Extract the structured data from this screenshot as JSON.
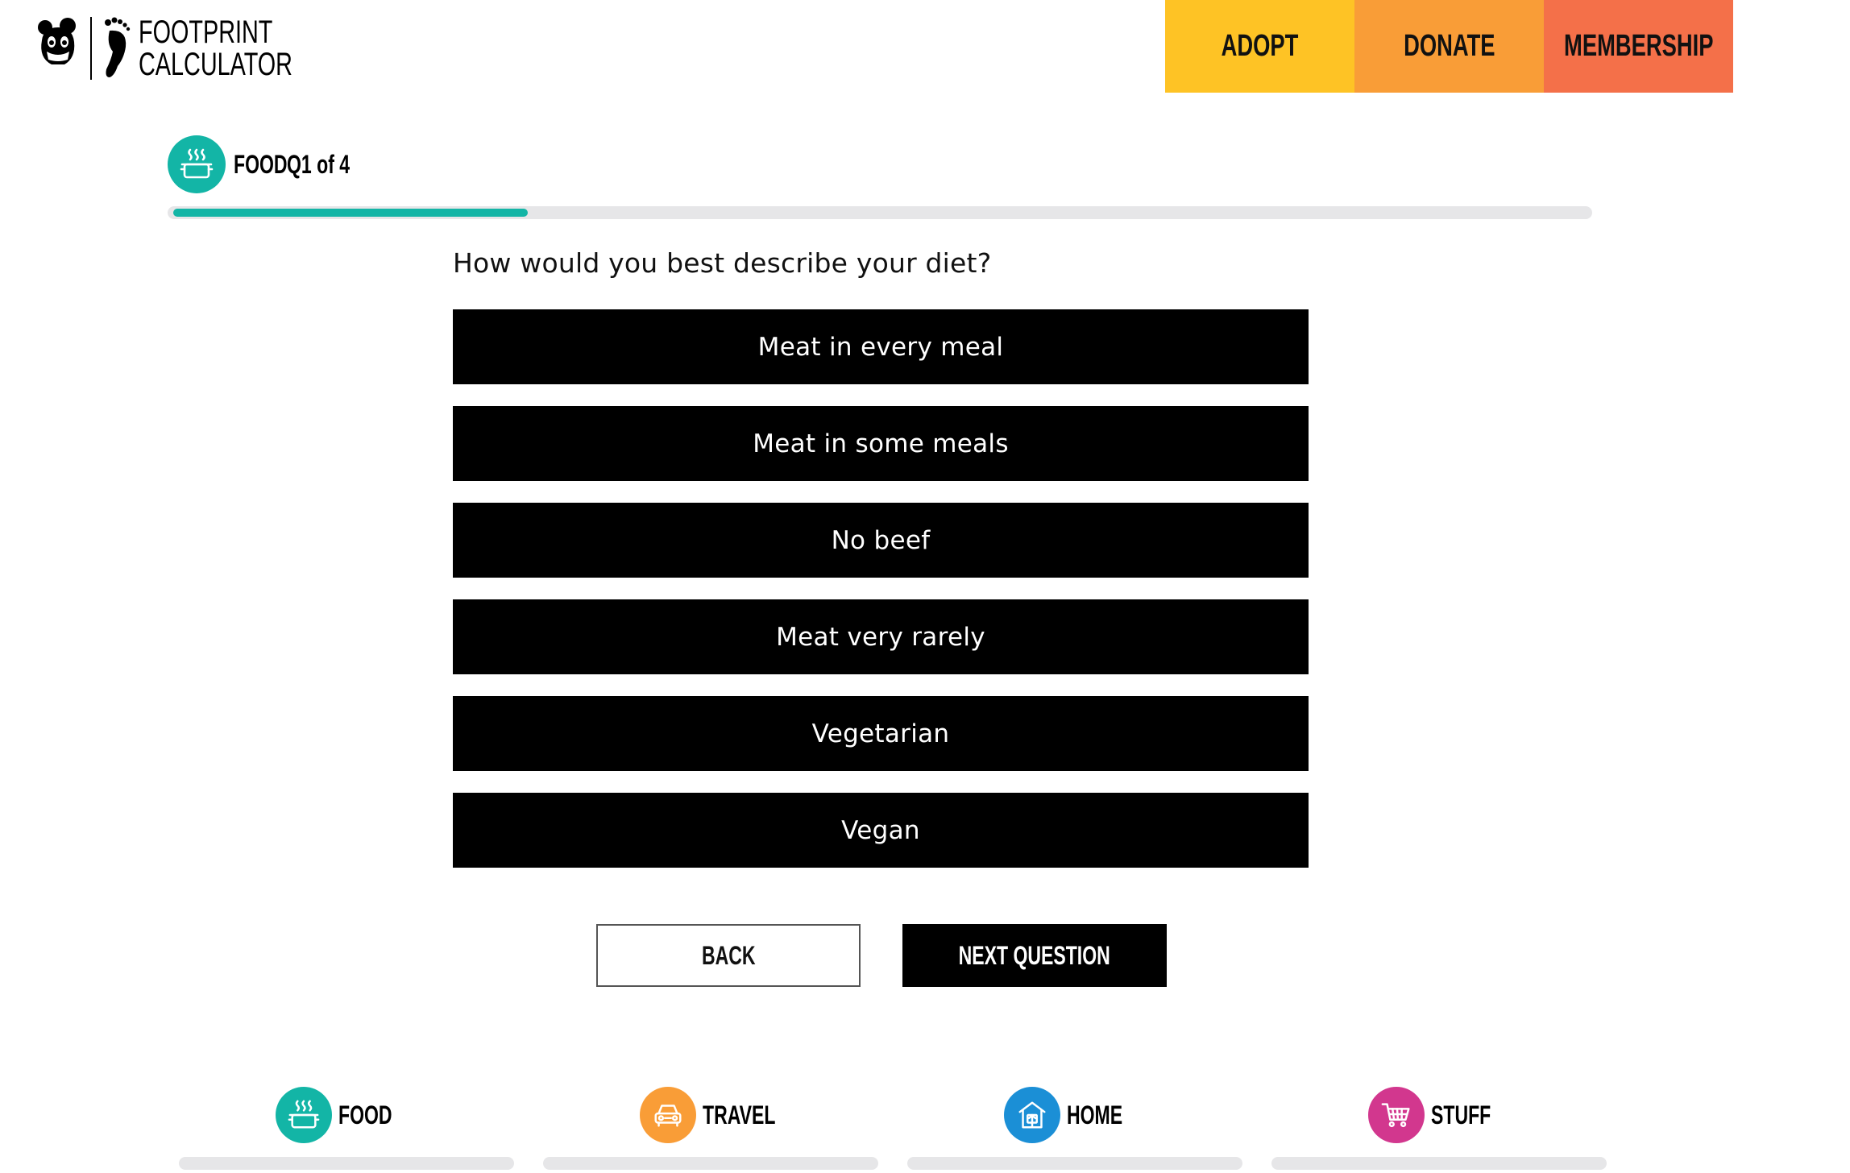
{
  "header": {
    "brand_mark": "WWF",
    "app_title_line1": "FOOTPRINT",
    "app_title_line2": "CALCULATOR",
    "nav": [
      {
        "label": "ADOPT",
        "color": "#fec325"
      },
      {
        "label": "DONATE",
        "color": "#f99d37"
      },
      {
        "label": "MEMBERSHIP",
        "color": "#f47049"
      }
    ]
  },
  "progress": {
    "category": "FOOD",
    "counter": "Q1 of 4",
    "fraction_complete": 0.25,
    "accent_color": "#13b5a6"
  },
  "question": {
    "text": "How would you best describe your diet?",
    "options": [
      "Meat in every meal",
      "Meat in some meals",
      "No beef",
      "Meat very rarely",
      "Vegetarian",
      "Vegan"
    ]
  },
  "buttons": {
    "back": "BACK",
    "next": "NEXT QUESTION"
  },
  "categories": [
    {
      "label": "FOOD",
      "icon": "food-pot-icon",
      "color": "#13b5a6"
    },
    {
      "label": "TRAVEL",
      "icon": "car-icon",
      "color": "#f99d37"
    },
    {
      "label": "HOME",
      "icon": "house-icon",
      "color": "#1b8fd6"
    },
    {
      "label": "STUFF",
      "icon": "shopping-cart-icon",
      "color": "#d2378e"
    }
  ]
}
